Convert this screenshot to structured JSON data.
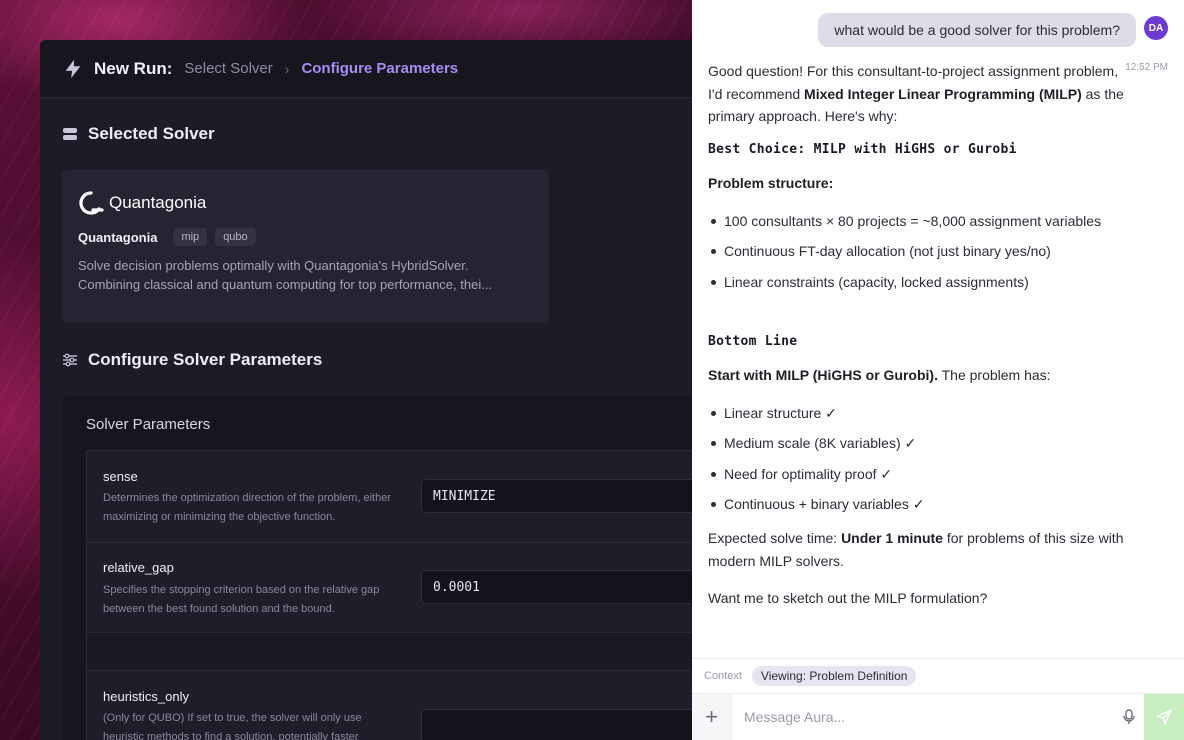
{
  "header": {
    "title": "New Run:",
    "breadcrumb": [
      "Select Solver",
      "Configure Parameters"
    ]
  },
  "selected_solver": {
    "section_title": "Selected Solver",
    "logo_text": "Quantagonia",
    "name": "Quantagonia",
    "tags": [
      "mip",
      "qubo"
    ],
    "description_line1": "Solve decision problems optimally with Quantagonia's HybridSolver.",
    "description_line2": "Combining classical and quantum computing for top performance, thei..."
  },
  "configure": {
    "section_title": "Configure Solver Parameters",
    "card_title": "Solver Parameters",
    "params": [
      {
        "name": "sense",
        "description": "Determines the optimization direction of the problem, either maximizing or minimizing the objective function.",
        "value": "MINIMIZE"
      },
      {
        "name": "relative_gap",
        "description": "Specifies the stopping criterion based on the relative gap between the best found solution and the bound.",
        "value": "0.0001"
      },
      {
        "name": "heuristics_only",
        "description": "(Only for QUBO) If set to true, the solver will only use heuristic methods to find a solution, potentially faster",
        "value": ""
      }
    ]
  },
  "chat": {
    "user_message": "what would be a good solver for this problem?",
    "user_initials": "DA",
    "timestamp": "12:52 PM",
    "intro_pre": "Good question! For this consultant-to-project assignment problem, I'd recommend ",
    "intro_bold": "Mixed Integer Linear Programming (MILP)",
    "intro_post": " as the primary approach. Here's why:",
    "heading1": "Best Choice: MILP with HiGHS or Gurobi",
    "structure_label": "Problem structure:",
    "structure_items": [
      "100 consultants × 80 projects = ~8,000 assignment variables",
      "Continuous FT-day allocation (not just binary yes/no)",
      "Linear constraints (capacity, locked assignments)"
    ],
    "heading2": "Bottom Line",
    "bottom_bold": "Start with MILP (HiGHS or Gurobi).",
    "bottom_post": " The problem has:",
    "bottom_items": [
      "Linear structure ✓",
      "Medium scale (8K variables) ✓",
      "Need for optimality proof ✓",
      "Continuous + binary variables ✓"
    ],
    "solve_pre": "Expected solve time: ",
    "solve_bold": "Under 1 minute",
    "solve_post": " for problems of this size with modern MILP solvers.",
    "closing": "Want me to sketch out the MILP formulation?",
    "context_label": "Context",
    "context_chip": "Viewing: Problem Definition",
    "input_placeholder": "Message Aura..."
  },
  "icons": {
    "header": "lightning-bolt-icon",
    "selected_solver": "database-icon",
    "configure": "sliders-icon",
    "chat_plus": "plus-icon",
    "chat_mic": "microphone-icon",
    "chat_send": "send-icon"
  },
  "colors": {
    "accent_purple": "#a88cf0",
    "avatar": "#6c3bd0",
    "send_button": "#c8edc0"
  }
}
